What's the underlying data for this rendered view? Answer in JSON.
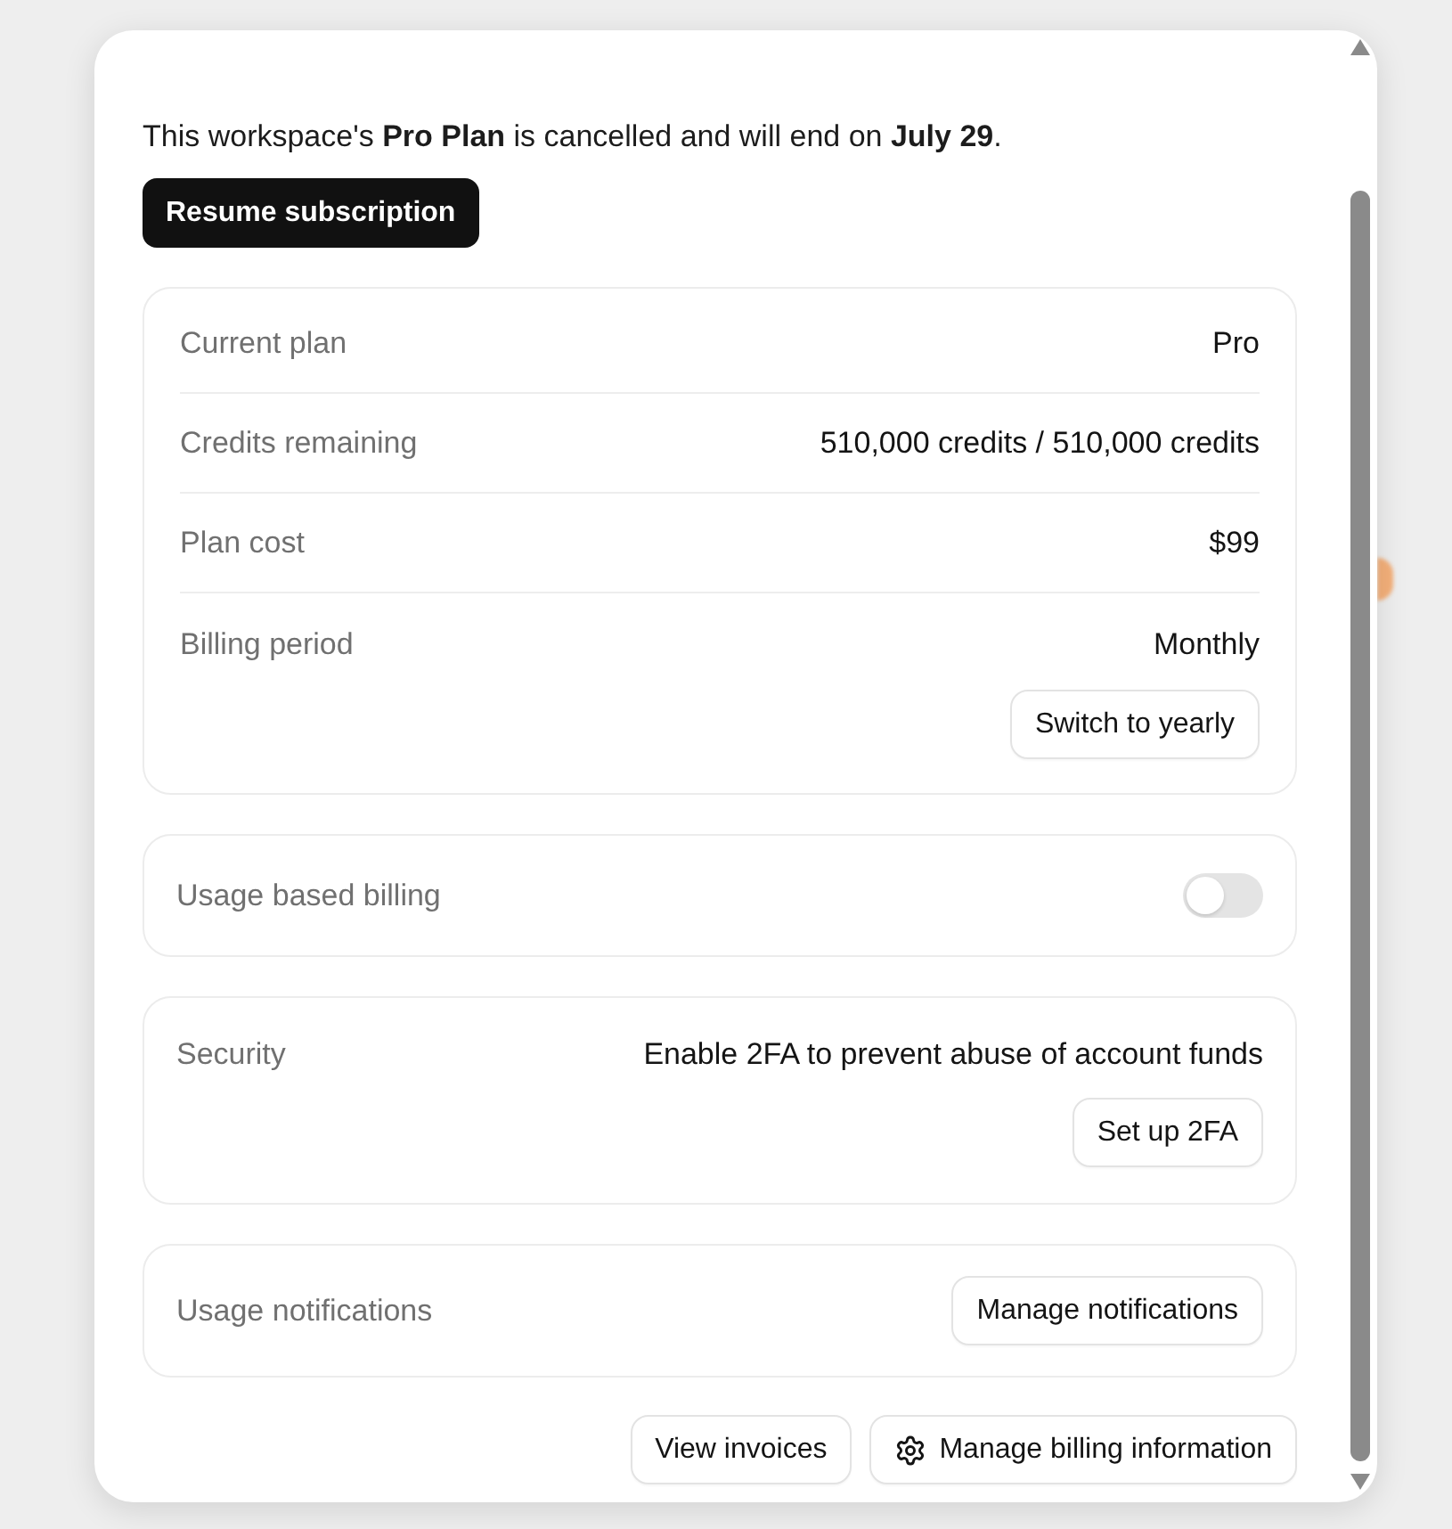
{
  "notice": {
    "text": "This workspace's **Pro Plan** is cancelled and will end on **July 29**.",
    "button": "Resume subscription"
  },
  "plan": {
    "rows": [
      {
        "label": "Current plan",
        "value": "Pro"
      },
      {
        "label": "Credits remaining",
        "value": "510,000 credits / 510,000 credits"
      },
      {
        "label": "Plan cost",
        "value": "$99"
      },
      {
        "label": "Billing period",
        "value": "Monthly"
      }
    ],
    "button": "Switch to yearly"
  },
  "usage_billing": {
    "label": "Usage based billing",
    "on": false
  },
  "security": {
    "label": "Security",
    "text": "Enable 2FA to prevent abuse of account funds",
    "button": "Set up 2FA"
  },
  "notifications": {
    "label": "Usage notifications",
    "button": "Manage notifications"
  },
  "footer_buttons": [
    {
      "label": "View invoices",
      "kind": "text"
    },
    {
      "label": "Manage billing information",
      "kind": "icon"
    }
  ]
}
